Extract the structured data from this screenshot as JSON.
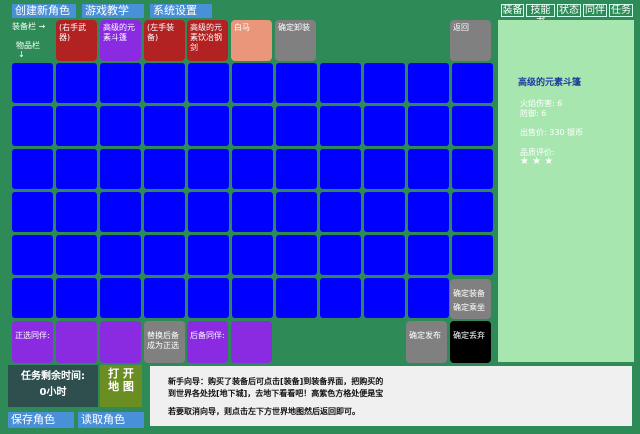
{
  "top_menu": {
    "create_role": "创建新角色",
    "tutorial": "游戏教学",
    "settings": "系统设置"
  },
  "right_tabs": [
    "装备",
    "技能书",
    "状态",
    "同伴",
    "任务"
  ],
  "equip_bar_label": "装备栏 →",
  "item_bar_label": "物品栏",
  "item_bar_arrow": "↓",
  "equip_slots": [
    {
      "label": "(右手武器)",
      "color": "#b22222"
    },
    {
      "label": "高级的元素斗篷",
      "color": "#8a2be2"
    },
    {
      "label": "(左手装备)",
      "color": "#b22222"
    },
    {
      "label": "高级的元素饮冶钢剑",
      "color": "#b22222"
    },
    {
      "label": "白马",
      "color": "#e9967a"
    },
    {
      "label": "确定卸装",
      "color": "#808080"
    },
    {
      "label": "返回",
      "color": "#808080"
    }
  ],
  "grid": {
    "rows": 6,
    "cols": 11,
    "cell_color": "#0000ff"
  },
  "grid_side_buttons": {
    "confirm_equip": "确定装备",
    "confirm_ride": "确定乘坐"
  },
  "bottom_row": [
    {
      "label": "正选同伴:",
      "color": "#8a2be2"
    },
    {
      "label": "",
      "color": "#8a2be2"
    },
    {
      "label": "",
      "color": "#8a2be2"
    },
    {
      "label": "替换后备成为正选",
      "color": "#808080"
    },
    {
      "label": "后备同伴:",
      "color": "#8a2be2"
    },
    {
      "label": "",
      "color": "#8a2be2"
    },
    {
      "label": "确定发布",
      "color": "#808080"
    },
    {
      "label": "确定丢弃",
      "color": "#000000"
    }
  ],
  "item_panel": {
    "title": "高级的元素斗篷",
    "fire_damage": "火焰伤害: 6",
    "defense": "防御: 6",
    "price": "出售价: 330 银币",
    "rating_label": "品质评价:",
    "rating_stars": "★ ★ ★"
  },
  "task_timer": {
    "label": "任务剩余时间:",
    "value": "0小时"
  },
  "open_map_button": "打 开\n地 图",
  "save_button": "保存角色",
  "load_button": "读取角色",
  "tutorial_dialog": {
    "line1": "新手向导：购买了装备后可点击[装备]到装备界面，把购买的",
    "line2": "到世界各处找[地下城]，去地下看看吧！高紫色方格处便是宝",
    "line3": "若要取消向导，则点击左下方世界地图然后返回即可。"
  },
  "colors": {
    "background": "#2e8b57",
    "menu_blue": "#4a90d9",
    "panel": "#a8e6b0",
    "title_blue": "#1e3a9e"
  }
}
